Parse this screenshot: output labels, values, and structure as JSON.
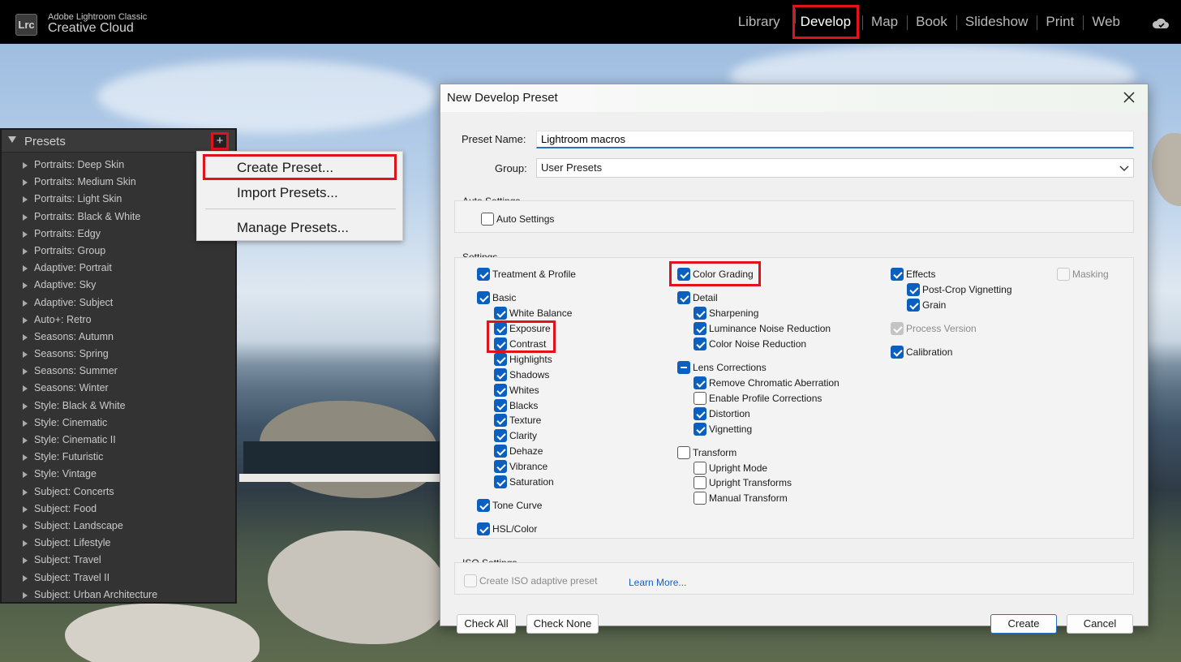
{
  "app": {
    "logo": "Lrc",
    "brand_line1": "Adobe Lightroom Classic",
    "brand_line2": "Creative Cloud",
    "modules": [
      "Library",
      "Develop",
      "Map",
      "Book",
      "Slideshow",
      "Print",
      "Web"
    ],
    "active_module": "Develop",
    "cloud_icon": "cloud-sync-icon"
  },
  "presets_panel": {
    "title": "Presets",
    "add_button": "+",
    "items": [
      "Portraits: Deep Skin",
      "Portraits: Medium Skin",
      "Portraits: Light Skin",
      "Portraits: Black & White",
      "Portraits: Edgy",
      "Portraits: Group",
      "Adaptive: Portrait",
      "Adaptive: Sky",
      "Adaptive: Subject",
      "Auto+: Retro",
      "Seasons: Autumn",
      "Seasons: Spring",
      "Seasons: Summer",
      "Seasons: Winter",
      "Style: Black & White",
      "Style: Cinematic",
      "Style: Cinematic II",
      "Style: Futuristic",
      "Style: Vintage",
      "Subject: Concerts",
      "Subject: Food",
      "Subject: Landscape",
      "Subject: Lifestyle",
      "Subject: Travel",
      "Subject: Travel II",
      "Subject: Urban Architecture"
    ]
  },
  "context_menu": {
    "create": "Create Preset...",
    "import": "Import Presets...",
    "manage": "Manage Presets..."
  },
  "dialog": {
    "title": "New Develop Preset",
    "preset_name_label": "Preset Name:",
    "preset_name_value": "Lightroom macros",
    "group_label": "Group:",
    "group_value": "User Presets",
    "auto_settings_title": "Auto Settings",
    "auto_settings_checkbox": "Auto Settings",
    "settings_title": "Settings",
    "col1": {
      "treatment": "Treatment & Profile",
      "basic": "Basic",
      "basic_children": [
        "White Balance",
        "Exposure",
        "Contrast",
        "Highlights",
        "Shadows",
        "Whites",
        "Blacks",
        "Texture",
        "Clarity",
        "Dehaze",
        "Vibrance",
        "Saturation"
      ],
      "tone_curve": "Tone Curve",
      "hsl": "HSL/Color"
    },
    "col2": {
      "color_grading": "Color Grading",
      "detail": "Detail",
      "detail_children": [
        "Sharpening",
        "Luminance Noise Reduction",
        "Color Noise Reduction"
      ],
      "lens": "Lens Corrections",
      "lens_children": [
        "Remove Chromatic Aberration",
        "Enable Profile Corrections",
        "Distortion",
        "Vignetting"
      ],
      "transform": "Transform",
      "transform_children": [
        "Upright Mode",
        "Upright Transforms",
        "Manual Transform"
      ]
    },
    "col3": {
      "effects": "Effects",
      "effects_children": [
        "Post-Crop Vignetting",
        "Grain"
      ],
      "process_version": "Process Version",
      "calibration": "Calibration"
    },
    "col4": {
      "masking": "Masking"
    },
    "iso_title": "ISO Settings",
    "iso_checkbox": "Create ISO adaptive preset",
    "learn_more": "Learn More...",
    "buttons": {
      "check_all": "Check All",
      "check_none": "Check None",
      "create": "Create",
      "cancel": "Cancel"
    }
  },
  "colors": {
    "highlight_red": "#e0121a",
    "checkbox_blue": "#0b5fbf"
  }
}
